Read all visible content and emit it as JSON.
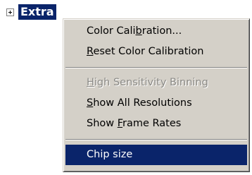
{
  "tree": {
    "expander_icon": "plus-box-icon",
    "node_label": "Extra"
  },
  "menu": {
    "items": [
      {
        "pre": "Color Cali",
        "key": "b",
        "post": "ration...",
        "enabled": true
      },
      {
        "pre": "",
        "key": "R",
        "post": "eset Color Calibration",
        "enabled": true
      },
      {
        "pre": "",
        "key": "H",
        "post": "igh Sensitivity Binning",
        "enabled": false
      },
      {
        "pre": "",
        "key": "S",
        "post": "how All Resolutions",
        "enabled": true
      },
      {
        "pre": "Show ",
        "key": "F",
        "post": "rame Rates",
        "enabled": true
      },
      {
        "pre": "Chip size",
        "key": "",
        "post": "",
        "enabled": true,
        "highlighted": true
      }
    ]
  },
  "colors": {
    "selection": "#0a246a",
    "menu_face": "#d4d0c8",
    "disabled_text": "#8b8a86"
  }
}
